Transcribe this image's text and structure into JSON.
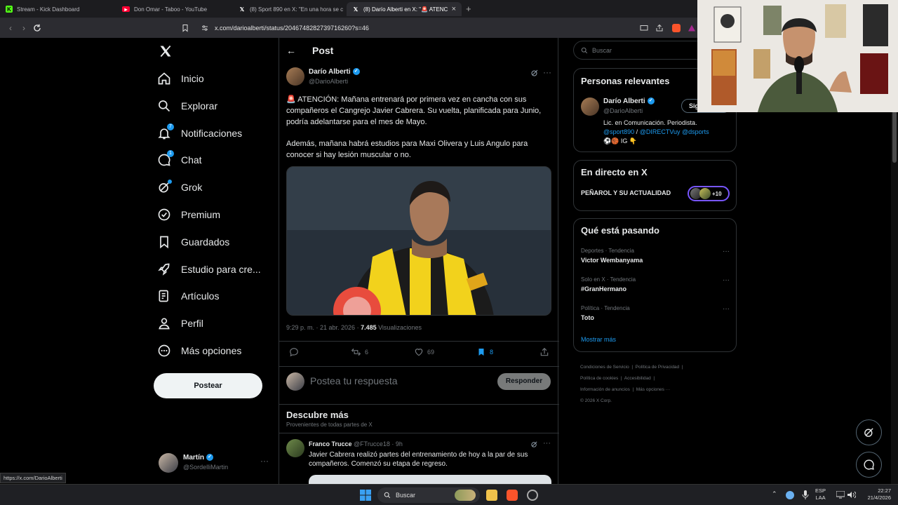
{
  "browser": {
    "tabs": [
      {
        "title": "Stream - Kick Dashboard",
        "icon": "kick-icon"
      },
      {
        "title": "Don Omar - Taboo - YouTube",
        "icon": "youtube-icon"
      },
      {
        "title": "(8) Sport 890 en X: \"En una hora se c",
        "icon": "x-icon"
      },
      {
        "title": "(8) Darío Alberti en X: \"🚨 ATENC",
        "icon": "x-icon"
      }
    ],
    "url": "x.com/darioalberti/status/2046748282739716260?s=46",
    "status_url": "https://x.com/DarioAlberti"
  },
  "sidebar": {
    "logo": "X",
    "items": [
      {
        "label": "Inicio",
        "icon": "home-icon"
      },
      {
        "label": "Explorar",
        "icon": "search-icon"
      },
      {
        "label": "Notificaciones",
        "icon": "bell-icon",
        "badge": "7"
      },
      {
        "label": "Chat",
        "icon": "chat-icon",
        "badge": "1"
      },
      {
        "label": "Grok",
        "icon": "grok-icon"
      },
      {
        "label": "Premium",
        "icon": "premium-icon"
      },
      {
        "label": "Guardados",
        "icon": "bookmark-icon"
      },
      {
        "label": "Estudio para cre...",
        "icon": "rocket-icon"
      },
      {
        "label": "Artículos",
        "icon": "article-icon"
      },
      {
        "label": "Perfil",
        "icon": "person-icon"
      },
      {
        "label": "Más opciones",
        "icon": "more-icon"
      }
    ],
    "post_button": "Postear",
    "account": {
      "name": "Martín",
      "handle": "@SordelliMartin"
    }
  },
  "main": {
    "header_title": "Post",
    "tweet": {
      "author": "Darío Alberti",
      "handle": "@DarioAlberti",
      "text1": "🚨 ATENCIÓN: Mañana entrenará por primera vez en cancha con sus compañeros el Cangrejo Javier Cabrera. Su vuelta, planificada para Junio, podría adelantarse para el mes de Mayo.",
      "text2": "Además, mañana habrá estudios para Maxi Olivera y Luis Angulo para conocer si hay lesión muscular o no.",
      "time": "9:29 p. m. · 21 abr. 2026 · ",
      "views": "7.485",
      "views_label": " Visualizaciones",
      "retweets": "6",
      "likes": "69",
      "bookmarks": "8"
    },
    "reply_placeholder": "Postea tu respuesta",
    "reply_button": "Responder",
    "discover_title": "Descubre más",
    "discover_sub": "Provenientes de todas partes de X",
    "second_tweet": {
      "author": "Franco Trucce",
      "handle": "@FTrucce18",
      "age": "· 9h",
      "text": "Javier Cabrera realizó partes del entrenamiento de hoy a la par de sus compañeros. Comenzó su etapa de regreso."
    }
  },
  "right": {
    "search_placeholder": "Buscar",
    "relevant_title": "Personas relevantes",
    "relevant": {
      "name": "Darío Alberti",
      "handle": "@DarioAlberti",
      "follow": "Sig",
      "bio_plain": "Lic. en Comunicación. Periodista.",
      "bio_link1": "@sport890",
      "bio_sep": " / ",
      "bio_link2": "@DIRECTVuy",
      "bio_link3": " @dsports",
      "bio_emoji": "⚽🏀 IG 👇"
    },
    "live_title": "En directo en X",
    "live_name": "PEÑAROL Y SU ACTUALIDAD",
    "live_count": "+10",
    "trends_title": "Qué está pasando",
    "trends": [
      {
        "category": "Deportes · Tendencia",
        "name": "Victor Wembanyama"
      },
      {
        "category": "Solo en X · Tendencia",
        "name": "#GranHermano"
      },
      {
        "category": "Política · Tendencia",
        "name": "Toto"
      }
    ],
    "show_more": "Mostrar más",
    "footer": [
      "Condiciones de Servicio",
      "Política de Privacidad",
      "Política de cookies",
      "Accesibilidad",
      "Información de anuncios",
      "Más opciones ···",
      "© 2026 X Corp."
    ]
  },
  "taskbar": {
    "search": "Buscar",
    "lang1": "ESP",
    "lang2": "LAA",
    "time": "22:27",
    "date": "21/4/2026"
  },
  "colors": {
    "accent": "#1d9bf0",
    "background": "#000000",
    "border": "#2f3336",
    "muted": "#71767b"
  }
}
